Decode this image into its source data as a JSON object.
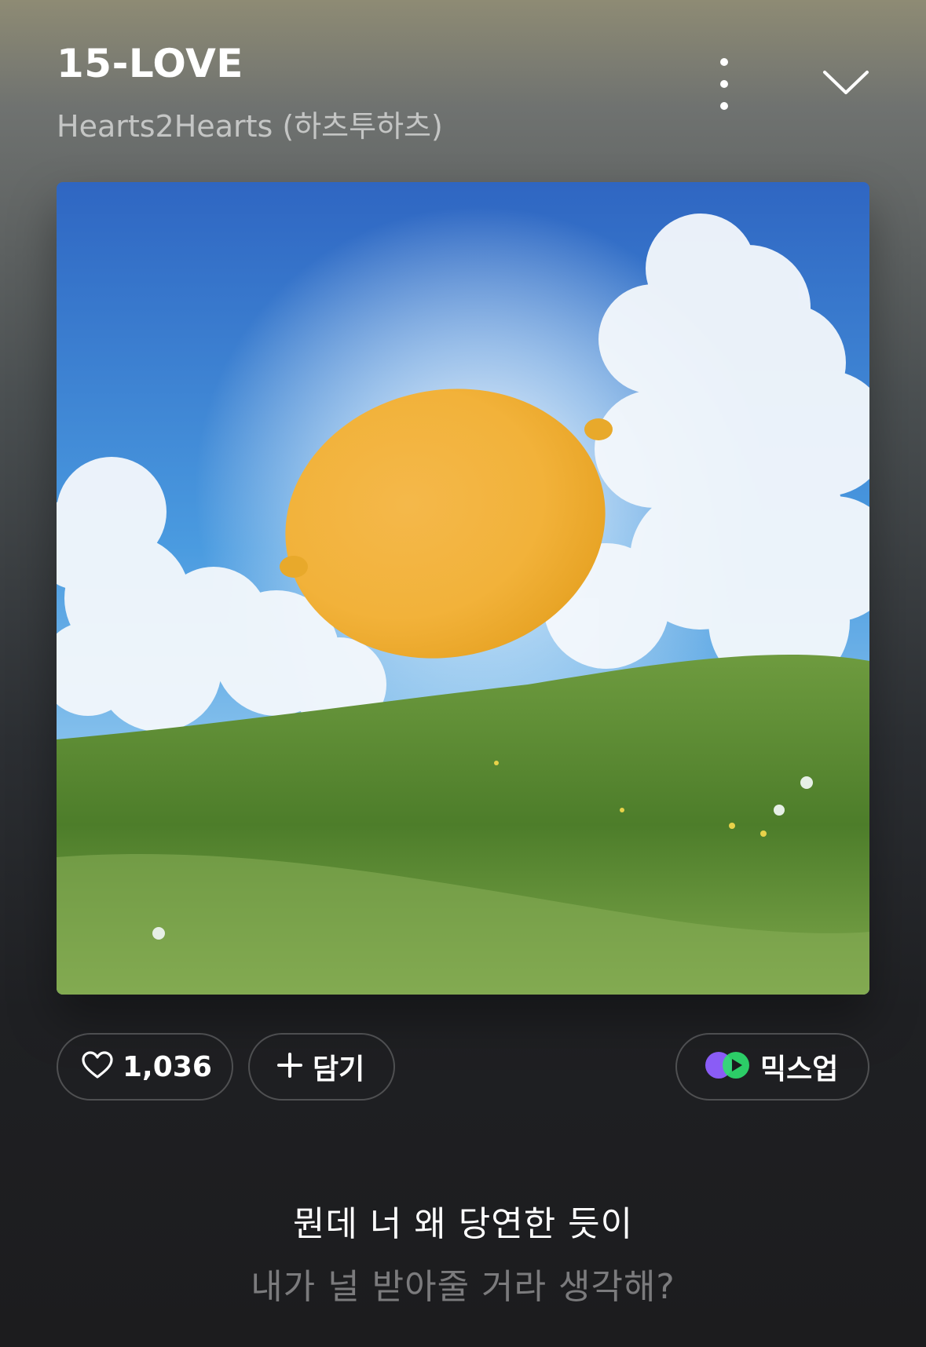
{
  "header": {
    "title": "15-LOVE",
    "artist": "Hearts2Hearts (하츠투하츠)"
  },
  "album_art": {
    "icon": "album-cover-lemon-sky"
  },
  "actions": {
    "like_count": "1,036",
    "add_label": "담기",
    "mixup_label": "믹스업"
  },
  "lyrics": {
    "current": "뭔데 너 왜 당연한 듯이",
    "next": "내가 널 받아줄 거라 생각해?"
  },
  "colors": {
    "accent_mix_purple": "#8a5cf6",
    "accent_mix_green": "#2ee06f"
  }
}
